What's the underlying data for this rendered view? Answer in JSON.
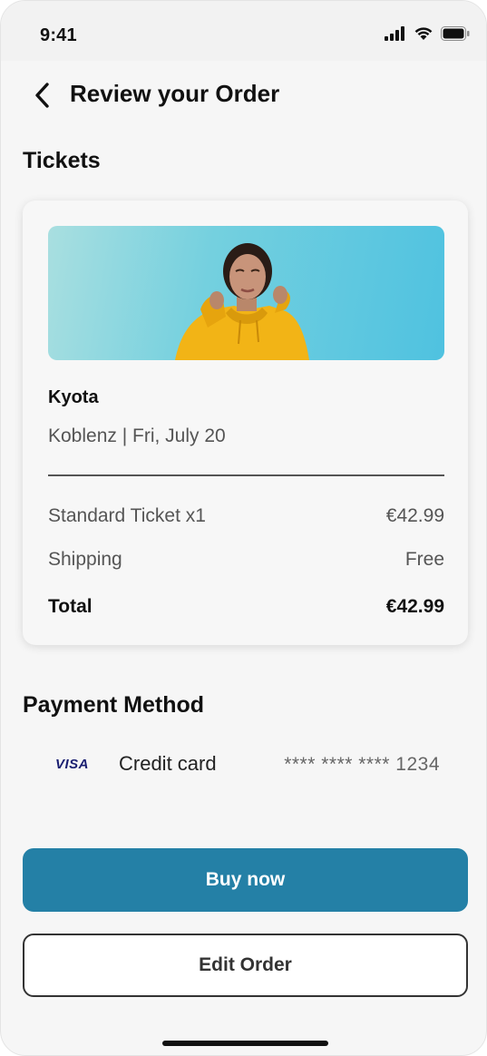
{
  "status_bar": {
    "time": "9:41"
  },
  "header": {
    "title": "Review your Order"
  },
  "tickets_section": {
    "title": "Tickets",
    "event": {
      "name": "Kyota",
      "meta": "Koblenz | Fri, July 20"
    },
    "lines": [
      {
        "label": "Standard Ticket x1",
        "value": "€42.99"
      },
      {
        "label": "Shipping",
        "value": "Free"
      }
    ],
    "total": {
      "label": "Total",
      "value": "€42.99"
    }
  },
  "payment_section": {
    "title": "Payment Method",
    "brand": "VISA",
    "method_label": "Credit card",
    "card_number": "**** **** **** 1234"
  },
  "actions": {
    "primary_label": "Buy now",
    "secondary_label": "Edit Order"
  },
  "colors": {
    "primary": "#2480a6",
    "background": "#f6f6f6",
    "visa": "#1a1f71",
    "hoodie": "#f2b416"
  }
}
